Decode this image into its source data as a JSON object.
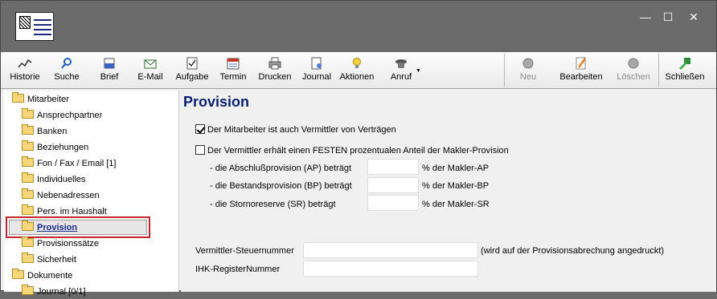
{
  "window": {
    "minimize": "—",
    "maximize": "☐",
    "close": "✕"
  },
  "toolbar": {
    "historie": "Historie",
    "suche": "Suche",
    "brief": "Brief",
    "email": "E-Mail",
    "aufgabe": "Aufgabe",
    "termin": "Termin",
    "drucken": "Drucken",
    "journal": "Journal",
    "aktionen": "Aktionen",
    "anruf": "Anruf",
    "neu": "Neu",
    "bearbeiten": "Bearbeiten",
    "loeschen": "Löschen",
    "schliessen": "Schließen"
  },
  "sidebar": {
    "items": [
      {
        "label": "Mitarbeiter"
      },
      {
        "label": "Ansprechpartner"
      },
      {
        "label": "Banken"
      },
      {
        "label": "Beziehungen"
      },
      {
        "label": "Fon / Fax / Email [1]"
      },
      {
        "label": "Individuelles"
      },
      {
        "label": "Nebenadressen"
      },
      {
        "label": "Pers. im Haushalt"
      },
      {
        "label": "Provision"
      },
      {
        "label": "Provisionssätze"
      },
      {
        "label": "Sicherheit"
      },
      {
        "label": "Dokumente"
      },
      {
        "label": "Journal [0/1]"
      }
    ]
  },
  "main": {
    "title": "Provision",
    "chk_vermittler": {
      "label": "Der Mitarbeiter ist auch Vermittler von Verträgen",
      "checked": true
    },
    "chk_fest": {
      "label": "Der Vermittler erhält einen FESTEN prozentualen Anteil der Makler-Provision",
      "checked": false
    },
    "ap_label": "- die Abschlußprovision (AP) beträgt",
    "ap_unit": "% der Makler-AP",
    "bp_label": "- die Bestandsprovision (BP) beträgt",
    "bp_unit": "% der Makler-BP",
    "sr_label": "- die Stornoreserve (SR) beträgt",
    "sr_unit": "% der Makler-SR",
    "steuer_label": "Vermittler-Steuernummer",
    "steuer_hint": "(wird auf der Provisionsabrechung angedruckt)",
    "ihk_label": "IHK-RegisterNummer"
  }
}
